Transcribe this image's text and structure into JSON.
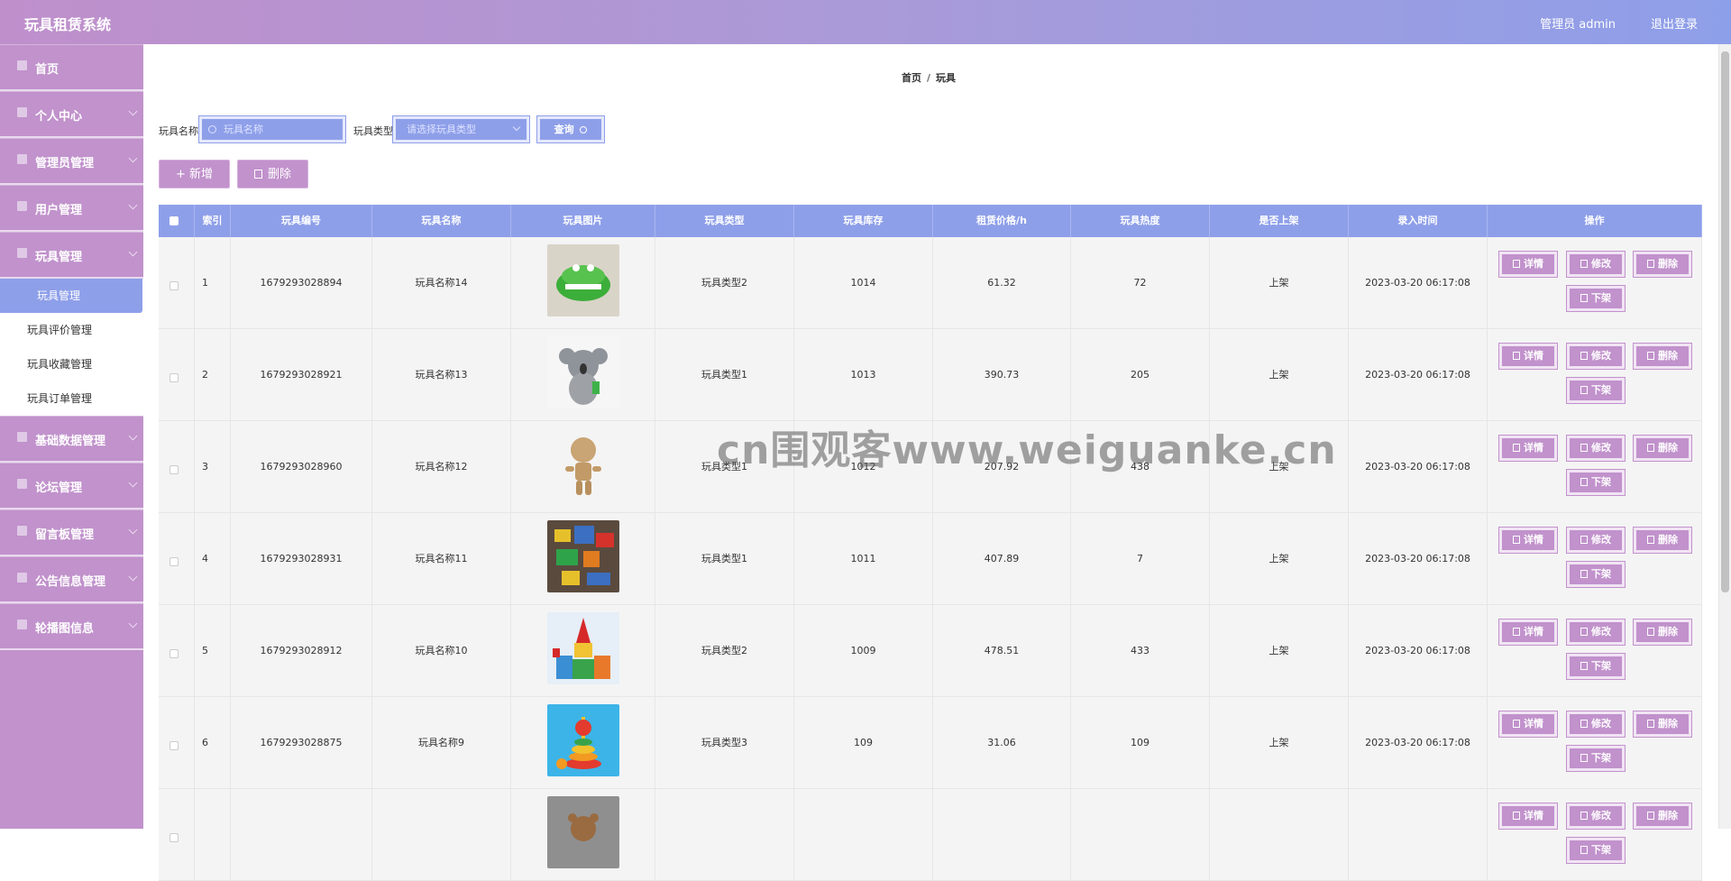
{
  "header": {
    "title": "玩具租赁系统",
    "admin": "管理员 admin",
    "logout": "退出登录"
  },
  "sidebar": {
    "items": [
      {
        "label": "首页",
        "icon": "home-icon",
        "expandable": false
      },
      {
        "label": "个人中心",
        "icon": "user-icon",
        "expandable": true
      },
      {
        "label": "管理员管理",
        "icon": "bar-chart-icon",
        "expandable": true
      },
      {
        "label": "用户管理",
        "icon": "flag-icon",
        "expandable": true
      },
      {
        "label": "玩具管理",
        "icon": "building-icon",
        "expandable": true
      },
      {
        "label": "基础数据管理",
        "icon": "building-icon",
        "expandable": true
      },
      {
        "label": "论坛管理",
        "icon": "grid-icon",
        "expandable": true
      },
      {
        "label": "留言板管理",
        "icon": "send-icon",
        "expandable": true
      },
      {
        "label": "公告信息管理",
        "icon": "building-icon",
        "expandable": true
      },
      {
        "label": "轮播图信息",
        "icon": "grid-icon",
        "expandable": true
      }
    ],
    "submenu": [
      "玩具管理",
      "玩具评价管理",
      "玩具收藏管理",
      "玩具订单管理"
    ]
  },
  "breadcrumb": {
    "home": "首页",
    "sep": "/",
    "current": "玩具"
  },
  "search": {
    "name_label": "玩具名称",
    "name_placeholder": "玩具名称",
    "type_label": "玩具类型",
    "type_placeholder": "请选择玩具类型",
    "query": "查询"
  },
  "actions": {
    "add": "+ 新增",
    "delete": "删除"
  },
  "table": {
    "headers": [
      "",
      "索引",
      "玩具编号",
      "玩具名称",
      "玩具图片",
      "玩具类型",
      "玩具库存",
      "租赁价格/h",
      "玩具热度",
      "是否上架",
      "录入时间",
      "操作"
    ],
    "rows": [
      {
        "idx": "1",
        "code": "1679293028894",
        "name": "玩具名称14",
        "type": "玩具类型2",
        "stock": "1014",
        "price": "61.32",
        "heat": "72",
        "status": "上架",
        "time": "2023-03-20 06:17:08",
        "img": "crocodile"
      },
      {
        "idx": "2",
        "code": "1679293028921",
        "name": "玩具名称13",
        "type": "玩具类型1",
        "stock": "1013",
        "price": "390.73",
        "heat": "205",
        "status": "上架",
        "time": "2023-03-20 06:17:08",
        "img": "koala"
      },
      {
        "idx": "3",
        "code": "1679293028960",
        "name": "玩具名称12",
        "type": "玩具类型1",
        "stock": "1012",
        "price": "207.92",
        "heat": "438",
        "status": "上架",
        "time": "2023-03-20 06:17:08",
        "img": "wooden"
      },
      {
        "idx": "4",
        "code": "1679293028931",
        "name": "玩具名称11",
        "type": "玩具类型1",
        "stock": "1011",
        "price": "407.89",
        "heat": "7",
        "status": "上架",
        "time": "2023-03-20 06:17:08",
        "img": "pile"
      },
      {
        "idx": "5",
        "code": "1679293028912",
        "name": "玩具名称10",
        "type": "玩具类型2",
        "stock": "1009",
        "price": "478.51",
        "heat": "433",
        "status": "上架",
        "time": "2023-03-20 06:17:08",
        "img": "blocks"
      },
      {
        "idx": "6",
        "code": "1679293028875",
        "name": "玩具名称9",
        "type": "玩具类型3",
        "stock": "109",
        "price": "31.06",
        "heat": "109",
        "status": "上架",
        "time": "2023-03-20 06:17:08",
        "img": "stacker"
      },
      {
        "idx": "",
        "code": "",
        "name": "",
        "type": "",
        "stock": "",
        "price": "",
        "heat": "",
        "status": "",
        "time": "",
        "img": "bear"
      }
    ],
    "ops": {
      "detail": "详情",
      "edit": "修改",
      "delete": "删除",
      "offshelf": "下架"
    }
  },
  "watermark": "cn围观客www.weiguanke.cn",
  "colors": {
    "purple": "#c192cc",
    "blue": "#8e9fe9"
  }
}
